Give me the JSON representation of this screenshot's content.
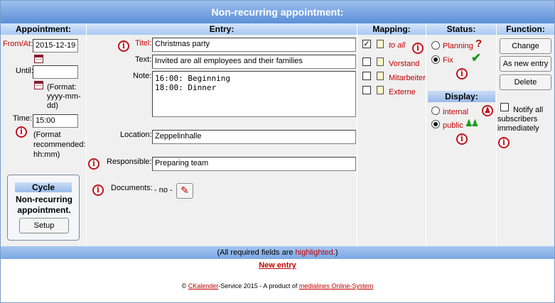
{
  "title": "Non-recurring appointment:",
  "headers": {
    "appointment": "Appointment:",
    "entry": "Entry:",
    "mapping": "Mapping:",
    "status": "Status:",
    "function": "Function:"
  },
  "appointment": {
    "from_label": "From/At:",
    "from_value": "2015-12-19",
    "until_label": "Until:",
    "until_value": "",
    "format_label": "(Format: yyyy-mm-dd)",
    "time_label": "Time:",
    "time_value": "15:00",
    "time_format": "(Format recommended: hh:mm)",
    "cycle_title": "Cycle",
    "cycle_text": "Non-recurring appointment.",
    "setup_button": "Setup"
  },
  "entry": {
    "title_label": "Titel:",
    "title_value": "Christmas party",
    "text_label": "Text:",
    "text_value": "Invited are all employees and their families",
    "note_label": "Note:",
    "note_value": "16:00: Beginning\n18:00: Dinner",
    "location_label": "Location:",
    "location_value": "Zeppelinhalle",
    "responsible_label": "Responsible:",
    "responsible_value": "Preparing team",
    "documents_label": "Documents:",
    "documents_value": "- no -"
  },
  "mapping": {
    "items": [
      {
        "label": "to all",
        "checked": true
      },
      {
        "label": "Vorstand",
        "checked": false
      },
      {
        "label": "Mitarbeiter",
        "checked": false
      },
      {
        "label": "Externe",
        "checked": false
      }
    ]
  },
  "status": {
    "planning": "Planning",
    "fix": "Fix",
    "selected": "Fix"
  },
  "display": {
    "header": "Display:",
    "internal": "internal",
    "public": "public",
    "selected": "public"
  },
  "functions": {
    "change": "Change",
    "as_new_entry": "As new entry",
    "delete": "Delete",
    "notify_label": "Notify all subscribers immediately"
  },
  "footer": {
    "required_prefix": "(All required fields are ",
    "required_highlight": "highlighted",
    "required_suffix": ".)",
    "new_entry": "New entry",
    "copyright_symbol": "©",
    "ckalender": "CKalender",
    "service_text": "-Service 2015 - A product of ",
    "medialines": "medialines Online-System"
  },
  "colors": {
    "accent_red": "#c00000",
    "header_blue": "#5b8fd8",
    "panel_gray": "#f0f0f0"
  }
}
